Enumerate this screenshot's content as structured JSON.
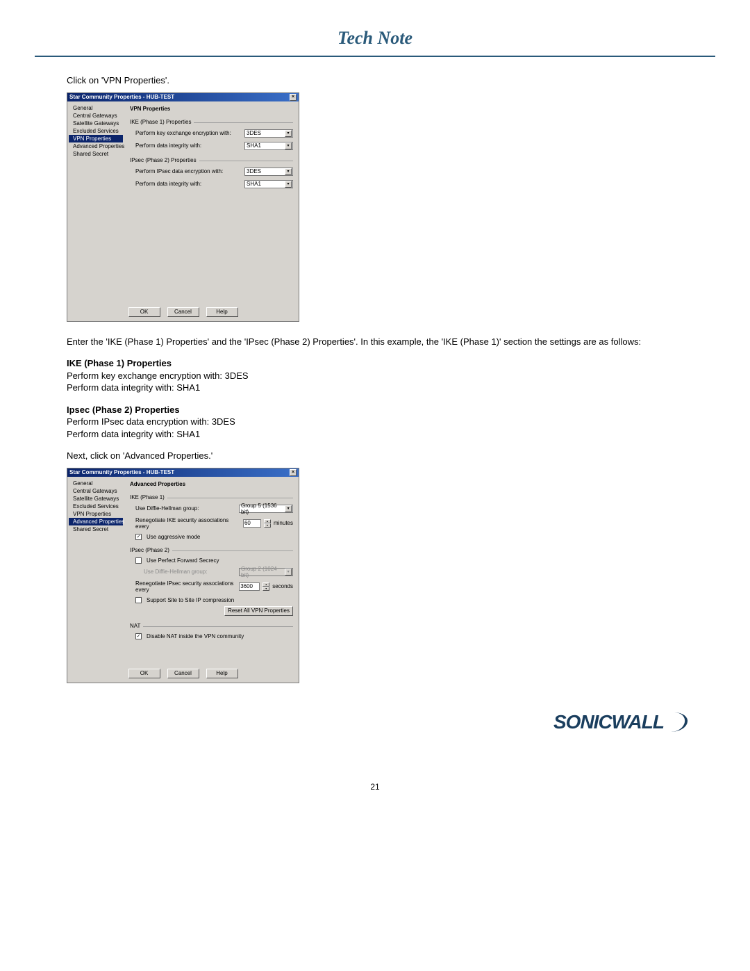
{
  "header": {
    "title": "Tech Note"
  },
  "text": {
    "p1": "Click on 'VPN Properties'.",
    "p2": "Enter the 'IKE (Phase 1) Properties' and the 'IPsec (Phase 2) Properties'. In this example, the 'IKE (Phase 1)' section the settings are as follows:",
    "h1": "IKE (Phase 1) Properties",
    "l1": "Perform key exchange encryption with: 3DES",
    "l2": "Perform data integrity with: SHA1",
    "h2": "Ipsec (Phase 2) Properties",
    "l3": "Perform IPsec data encryption with: 3DES",
    "l4": "Perform data integrity with: SHA1",
    "p3": "Next, click on 'Advanced Properties.'"
  },
  "dialog1": {
    "title": "Star Community Properties - HUB-TEST",
    "tree": [
      "General",
      "Central Gateways",
      "Satellite Gateways",
      "Excluded Services",
      "VPN Properties",
      "Advanced Properties",
      "Shared Secret"
    ],
    "selectedIndex": 4,
    "panelTitle": "VPN Properties",
    "grp1": "IKE (Phase 1) Properties",
    "r1label": "Perform key exchange encryption with:",
    "r1value": "3DES",
    "r2label": "Perform data integrity with:",
    "r2value": "SHA1",
    "grp2": "IPsec (Phase 2) Properties",
    "r3label": "Perform IPsec data encryption with:",
    "r3value": "3DES",
    "r4label": "Perform data integrity with:",
    "r4value": "SHA1",
    "ok": "OK",
    "cancel": "Cancel",
    "help": "Help"
  },
  "dialog2": {
    "title": "Star Community Properties - HUB-TEST",
    "tree": [
      "General",
      "Central Gateways",
      "Satellite Gateways",
      "Excluded Services",
      "VPN Properties",
      "Advanced Properties",
      "Shared Secret"
    ],
    "selectedIndex": 5,
    "panelTitle": "Advanced Properties",
    "grpIKE": "IKE (Phase 1)",
    "dhLabel": "Use Diffie-Hellman group:",
    "dhValue": "Group 5 (1536 bit)",
    "renegIKELabel": "Renegotiate IKE security associations every",
    "renegIKEValue": "60",
    "renegIKEUnit": "minutes",
    "aggressive": "Use aggressive mode",
    "aggressiveChecked": true,
    "grpIPsec": "IPsec (Phase 2)",
    "pfs": "Use Perfect Forward Secrecy",
    "pfsChecked": false,
    "dh2Label": "Use Diffie-Hellman group:",
    "dh2Value": "Group 2 (1024 bit)",
    "renegIPsecLabel": "Renegotiate IPsec security associations every",
    "renegIPsecValue": "3600",
    "renegIPsecUnit": "seconds",
    "compress": "Support Site to Site IP compression",
    "compressChecked": false,
    "resetBtn": "Reset All VPN Properties",
    "grpNAT": "NAT",
    "disableNAT": "Disable NAT inside the VPN community",
    "disableNATChecked": true,
    "ok": "OK",
    "cancel": "Cancel",
    "help": "Help"
  },
  "footer": {
    "pageNumber": "21",
    "logo": "SONICWALL"
  }
}
